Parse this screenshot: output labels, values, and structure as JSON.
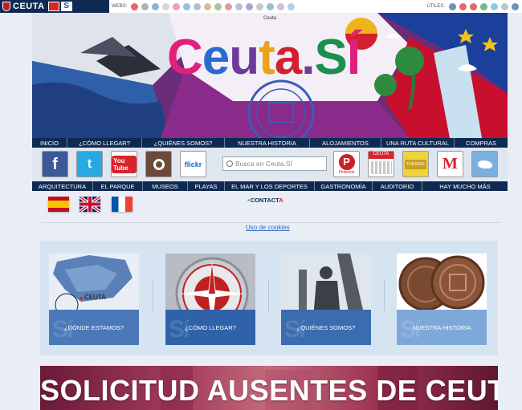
{
  "topbar": {
    "brand": "CEUTA",
    "brand_badge": "S",
    "webs_label": "WEBS:",
    "utiles_label": "ÚTILES:"
  },
  "banner": {
    "tag": "Ceuta",
    "logo": {
      "c": "C",
      "e": "e",
      "u": "u",
      "t": "t",
      "a": "a",
      "dot": ".",
      "s": "S",
      "i": "Í"
    },
    "colors": {
      "c": "#e2207a",
      "e": "#2a6bd0",
      "u": "#6c3b9a",
      "t": "#e8a317",
      "a": "#d2202f",
      "s": "#1c8f4e",
      "i": "#e2207a"
    }
  },
  "menu_top": [
    "Inicio",
    "¿Cómo llegar?",
    "¿Quiénes somos?",
    "Nuestra Historia",
    "Alojamientos",
    "Una ruta cultural",
    "Compras"
  ],
  "menu_bottom": [
    "Arquitectura",
    "El Parque",
    "Museos",
    "Playas",
    "El mar y los deportes",
    "Gastronomía",
    "Auditorio",
    "Hay mucho más"
  ],
  "social": {
    "facebook": "f",
    "twitter": "t",
    "youtube": "You Tube",
    "flickr": "flickr",
    "pinterest": "P",
    "pinterest_caption": "Pinterest",
    "calendar_caption": "CEUTA",
    "theatre_caption": "THEATRE"
  },
  "search": {
    "placeholder": "Busca en Ceuta.SÍ"
  },
  "contact": {
    "dot": "•",
    "label_main": "CONTACT",
    "label_accent": "A"
  },
  "cookies": "Uso de cookies",
  "cards": [
    {
      "label": "¿DÓNDE ESTAMOS?",
      "map_label": "CEUTA"
    },
    {
      "label": "¿CÓMO LLEGAR?"
    },
    {
      "label": "¿QUIÉNES SOMOS?"
    },
    {
      "label": "NUESTRA HISTORIA"
    }
  ],
  "card_watermark": "Sí",
  "promo": "SOLICITUD AUSENTES DE CEUTA"
}
